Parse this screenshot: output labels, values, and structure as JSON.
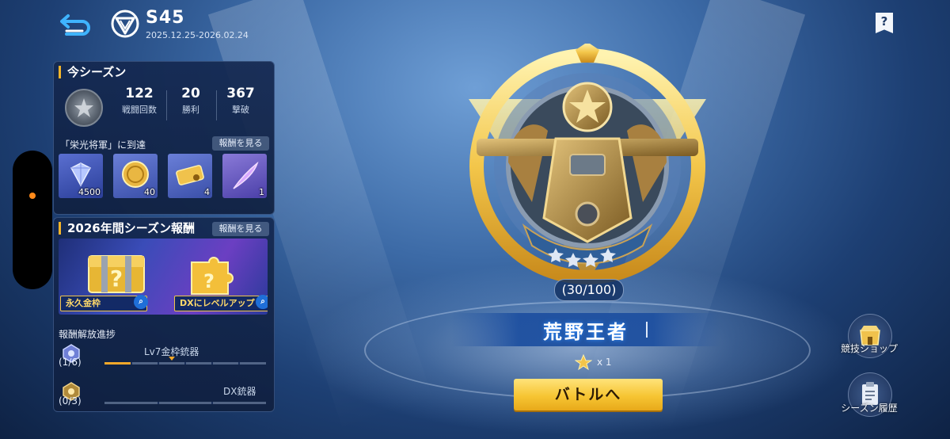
{
  "header": {
    "season": "S45",
    "dates": "2025.12.25-2026.02.24",
    "help_icon": "?"
  },
  "current_season": {
    "title": "今シーズン",
    "stats": [
      {
        "value": "122",
        "label": "戦闘回数"
      },
      {
        "value": "20",
        "label": "勝利"
      },
      {
        "value": "367",
        "label": "撃破"
      }
    ],
    "reach_text": "「栄光将軍」に到達",
    "see_rewards": "報酬を見る",
    "rewards": [
      {
        "icon": "diamond-icon",
        "count": "4500"
      },
      {
        "icon": "gold-coin-icon",
        "count": "40"
      },
      {
        "icon": "gold-ticket-icon",
        "count": "4"
      },
      {
        "icon": "purple-feather-icon",
        "count": "1"
      }
    ]
  },
  "annual": {
    "title": "2026年間シーズン報酬",
    "see_rewards": "報酬を見る",
    "tags": [
      "永久金枠",
      "DXにレベルアップ"
    ],
    "progress_title": "報酬解放進捗",
    "tracks": [
      {
        "name": "Lv7金枠銃器",
        "count": "(1/6)",
        "progress": 0.167
      },
      {
        "name": "DX銃器",
        "count": "(0/3)",
        "progress": 0.0
      }
    ]
  },
  "rank": {
    "progress": "(30/100)",
    "name": "荒野王者",
    "star_count": "x 1",
    "battle_button": "バトルへ"
  },
  "side": {
    "shop_label": "競技ショップ",
    "history_label": "シーズン履歴"
  },
  "colors": {
    "accent": "#f5b52a",
    "gold": "#f6c533",
    "banner_blue": "#1e50a0"
  }
}
